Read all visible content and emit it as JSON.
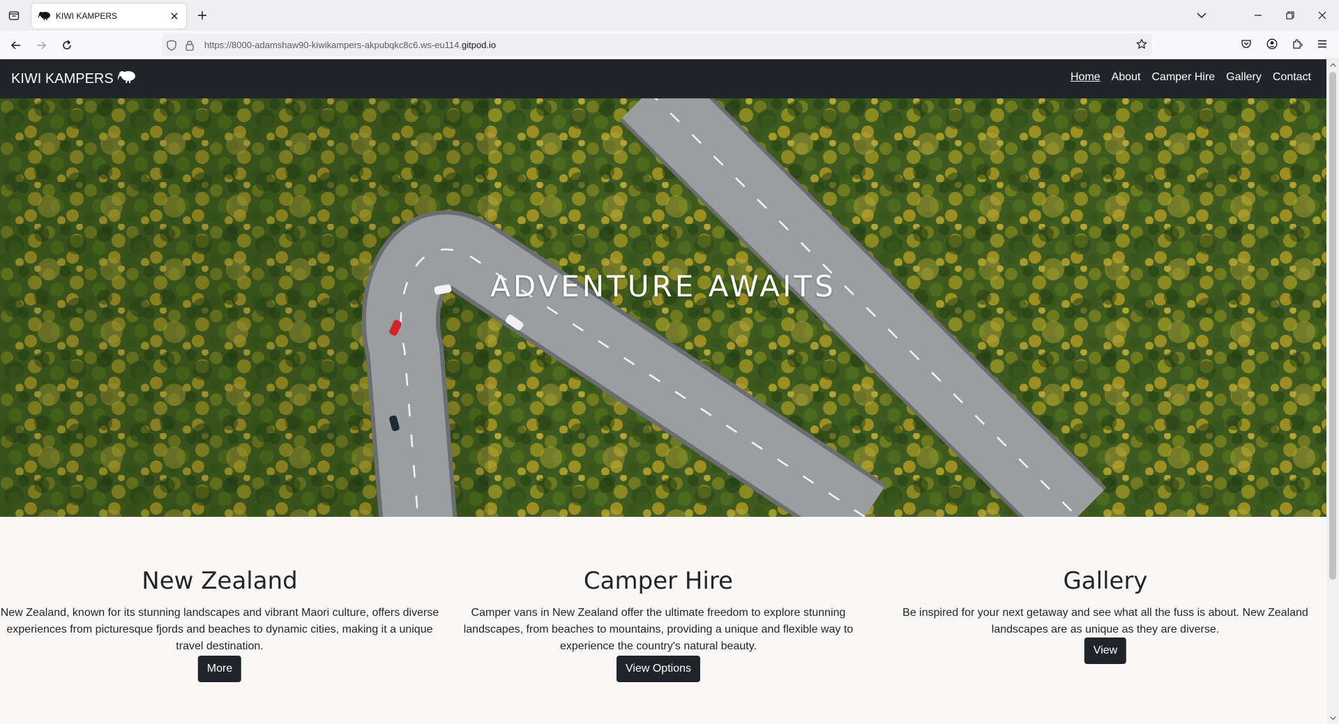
{
  "browser": {
    "tab": {
      "title": "KIWI KAMPERS",
      "favicon": "kiwi-bird-icon"
    },
    "url": {
      "prefix": "https://8000-adamshaw90-kiwikampers-akpubqkc8c6.ws-eu114.",
      "domain": "gitpod.io"
    }
  },
  "site": {
    "brand": "KIWI KAMPERS",
    "nav": [
      {
        "label": "Home",
        "active": true
      },
      {
        "label": "About"
      },
      {
        "label": "Camper Hire"
      },
      {
        "label": "Gallery"
      },
      {
        "label": "Contact"
      }
    ],
    "hero": {
      "title": "ADVENTURE AWAITS"
    },
    "cards": [
      {
        "title": "New Zealand",
        "text": "New Zealand, known for its stunning landscapes and vibrant Maori culture, offers diverse experiences from picturesque fjords and beaches to dynamic cities, making it a unique travel destination.",
        "button": "More"
      },
      {
        "title": "Camper Hire",
        "text": "Camper vans in New Zealand offer the ultimate freedom to explore stunning landscapes, from beaches to mountains, providing a unique and flexible way to experience the country's natural beauty.",
        "button": "View Options"
      },
      {
        "title": "Gallery",
        "text": "Be inspired for your next getaway and see what all the fuss is about. New Zealand landscapes are as unique as they are diverse.",
        "button": "View"
      }
    ]
  },
  "colors": {
    "navbar": "#212529",
    "page_bg": "#f9f8f6",
    "button": "#212529"
  }
}
